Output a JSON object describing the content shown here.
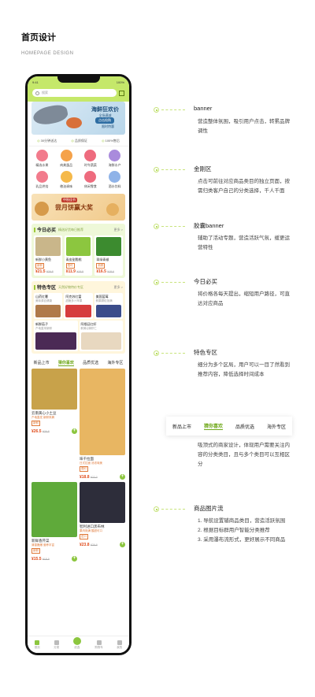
{
  "header": {
    "title": "首页设计",
    "subtitle": "HOMEPAGE DESIGN"
  },
  "phone": {
    "status": {
      "time": "9:41",
      "right": "100%"
    },
    "search": {
      "placeholder": "搜索"
    },
    "banner": {
      "title": "海鲜狂欢价",
      "subtitle": "全场满减",
      "button": "点击抢购",
      "note": "限时特惠"
    },
    "services": [
      "30分钟送达",
      "品质保证",
      "100%售后"
    ],
    "categories": [
      {
        "label": "精选水果",
        "color": "#f27b8c"
      },
      {
        "label": "肉禽蛋品",
        "color": "#f5a24a"
      },
      {
        "label": "时令蔬菜",
        "color": "#ee6b7e"
      },
      {
        "label": "海鲜水产",
        "color": "#a98bdc"
      },
      {
        "label": "乳品烘焙",
        "color": "#f27b8c"
      },
      {
        "label": "粮油调味",
        "color": "#f5b94a"
      },
      {
        "label": "休闲零食",
        "color": "#ee6b7e"
      },
      {
        "label": "酒水饮料",
        "color": "#8fb3e8"
      }
    ],
    "promo": {
      "tag": "中秋佳节",
      "title": "尝月饼赢大奖"
    },
    "daily": {
      "title": "今日必买",
      "sub": "精选好货每日推荐",
      "more": "更多 >",
      "items": [
        {
          "name": "新鲜小黄鱼",
          "tag": "新鲜",
          "price": "¥21.5",
          "old": "¥29.8",
          "color": "#c9b68a"
        },
        {
          "name": "青皮甜脆桃",
          "tag": "限时",
          "price": "¥11.9",
          "old": "¥15.5",
          "color": "#8cc63f"
        },
        {
          "name": "翠绿青椒",
          "tag": "新鲜",
          "price": "¥16.5",
          "old": "¥18.0",
          "color": "#3c8b2f"
        }
      ]
    },
    "feature": {
      "title": "特色专区",
      "sub": "天然好物特价专区",
      "more": "更多 >",
      "cells": [
        {
          "name": "山药红薯",
          "sub": "美味源自健康",
          "color": "#b07a4a"
        },
        {
          "name": "阿克苏红富",
          "sub": "甜脆多汁苹果",
          "color": "#d63c3c"
        },
        {
          "name": "美国蓝莓",
          "sub": "鲜果颗粒饱满",
          "color": "#3b4c8a"
        }
      ],
      "cells2": [
        {
          "name": "新鲜茄子",
          "sub": "产地直采新鲜",
          "color": "#4b2a55"
        },
        {
          "name": "阿根廷红虾",
          "sub": "鲜美Q弹虾仁",
          "color": "#e8d8c0"
        }
      ]
    },
    "tabs": [
      "新品上市",
      "猜你喜欢",
      "品质优选",
      "海外专区"
    ],
    "goods": [
      {
        "name": "云南黄心小土豆",
        "desc": "产地直发 新鲜采摘",
        "tag": "新鲜",
        "price": "¥26.5",
        "old": "¥29.8",
        "color": "#c8a24a",
        "img_h": 52
      },
      {
        "name": "味千拉面",
        "desc": "日式拉面 汤浓味美",
        "tag": "限时",
        "price": "¥18.8",
        "old": "¥22.0",
        "color": "#e8b662",
        "img_h": 110
      },
      {
        "name": "新鲜香芹菜",
        "desc": "清香脆嫩 营养丰富",
        "tag": "新鲜",
        "price": "¥15.5",
        "old": "¥18.9",
        "color": "#5faa3a",
        "img_h": 70
      },
      {
        "name": "智利进口黑布林",
        "desc": "果肉饱满 酸甜可口",
        "tag": "进口",
        "price": "¥23.8",
        "old": "¥29.9",
        "color": "#2d2d3a",
        "img_h": 52
      }
    ],
    "tabbar": [
      {
        "label": "首页",
        "active": true,
        "center": false
      },
      {
        "label": "分类",
        "active": false,
        "center": false
      },
      {
        "label": "优选",
        "active": false,
        "center": true
      },
      {
        "label": "购物车",
        "active": false,
        "center": false
      },
      {
        "label": "我的",
        "active": false,
        "center": false
      }
    ]
  },
  "annotations": [
    {
      "title": "banner",
      "desc": "营造整体氛围，吸引用户点击，转累品牌调性"
    },
    {
      "title": "金刚区",
      "desc": "点击可前往对应商品类目的独立页面，按需归类客户自己的分类选择，千人千面"
    },
    {
      "title": "胶囊banner",
      "desc": "辅助了活动专题，营造活跃气氛，缓更运营特性"
    },
    {
      "title": "今日必买",
      "desc": "将价格各每天提出，缩短用户路径，可直达对应商品"
    },
    {
      "title": "特色专区",
      "desc": "细分为多个区局，用户可以一目了然看到推荐内容，降低选择时间成本"
    },
    {
      "title": "",
      "desc": "吸顶式的商家设计，体现用户需要关注内容的分类类目，且与多个类目可以互相区分"
    },
    {
      "title": "商品图片流",
      "desc_list": [
        "1. 导航设置辅商品类目，营造活跃氛围",
        "2. 根据目标群用户智能分类推荐",
        "3. 采用瀑布流形式，更好展示不同商品"
      ]
    }
  ],
  "tab_demo": [
    "新品上市",
    "猜你喜欢",
    "品质优选",
    "海外专区"
  ]
}
